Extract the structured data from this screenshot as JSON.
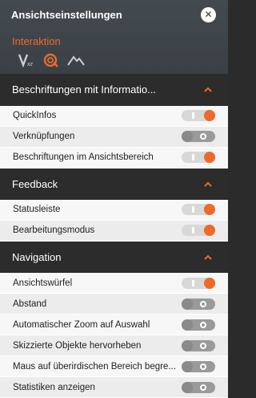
{
  "header": {
    "title": "Ansichtseinstellungen",
    "close_label": "✕",
    "tab": "Interaktion",
    "icons": [
      "viewcube-icon",
      "orbit-icon",
      "terrain-icon"
    ]
  },
  "sections": {
    "annotations": {
      "title": "Beschriftungen mit Informatio...",
      "items": [
        {
          "label": "QuickInfos",
          "on": true
        },
        {
          "label": "Verknüpfungen",
          "on": false
        },
        {
          "label": "Beschriftungen im Ansichtsbereich",
          "on": true
        }
      ]
    },
    "feedback": {
      "title": "Feedback",
      "items": [
        {
          "label": "Statusleiste",
          "on": true
        },
        {
          "label": "Bearbeitungsmodus",
          "on": true
        }
      ]
    },
    "navigation": {
      "title": "Navigation",
      "items": [
        {
          "label": "Ansichtswürfel",
          "on": true
        },
        {
          "label": "Abstand",
          "on": false
        },
        {
          "label": "Automatischer Zoom auf Auswahl",
          "on": false
        },
        {
          "label": "Skizzierte Objekte hervorheben",
          "on": false
        },
        {
          "label": "Maus auf überirdischen Bereich begre...",
          "on": false
        },
        {
          "label": "Statistiken anzeigen",
          "on": false
        }
      ]
    }
  },
  "colors": {
    "accent": "#ee6a2a",
    "header_bg": "#3d4349",
    "section_bg": "#2c2c2c"
  }
}
